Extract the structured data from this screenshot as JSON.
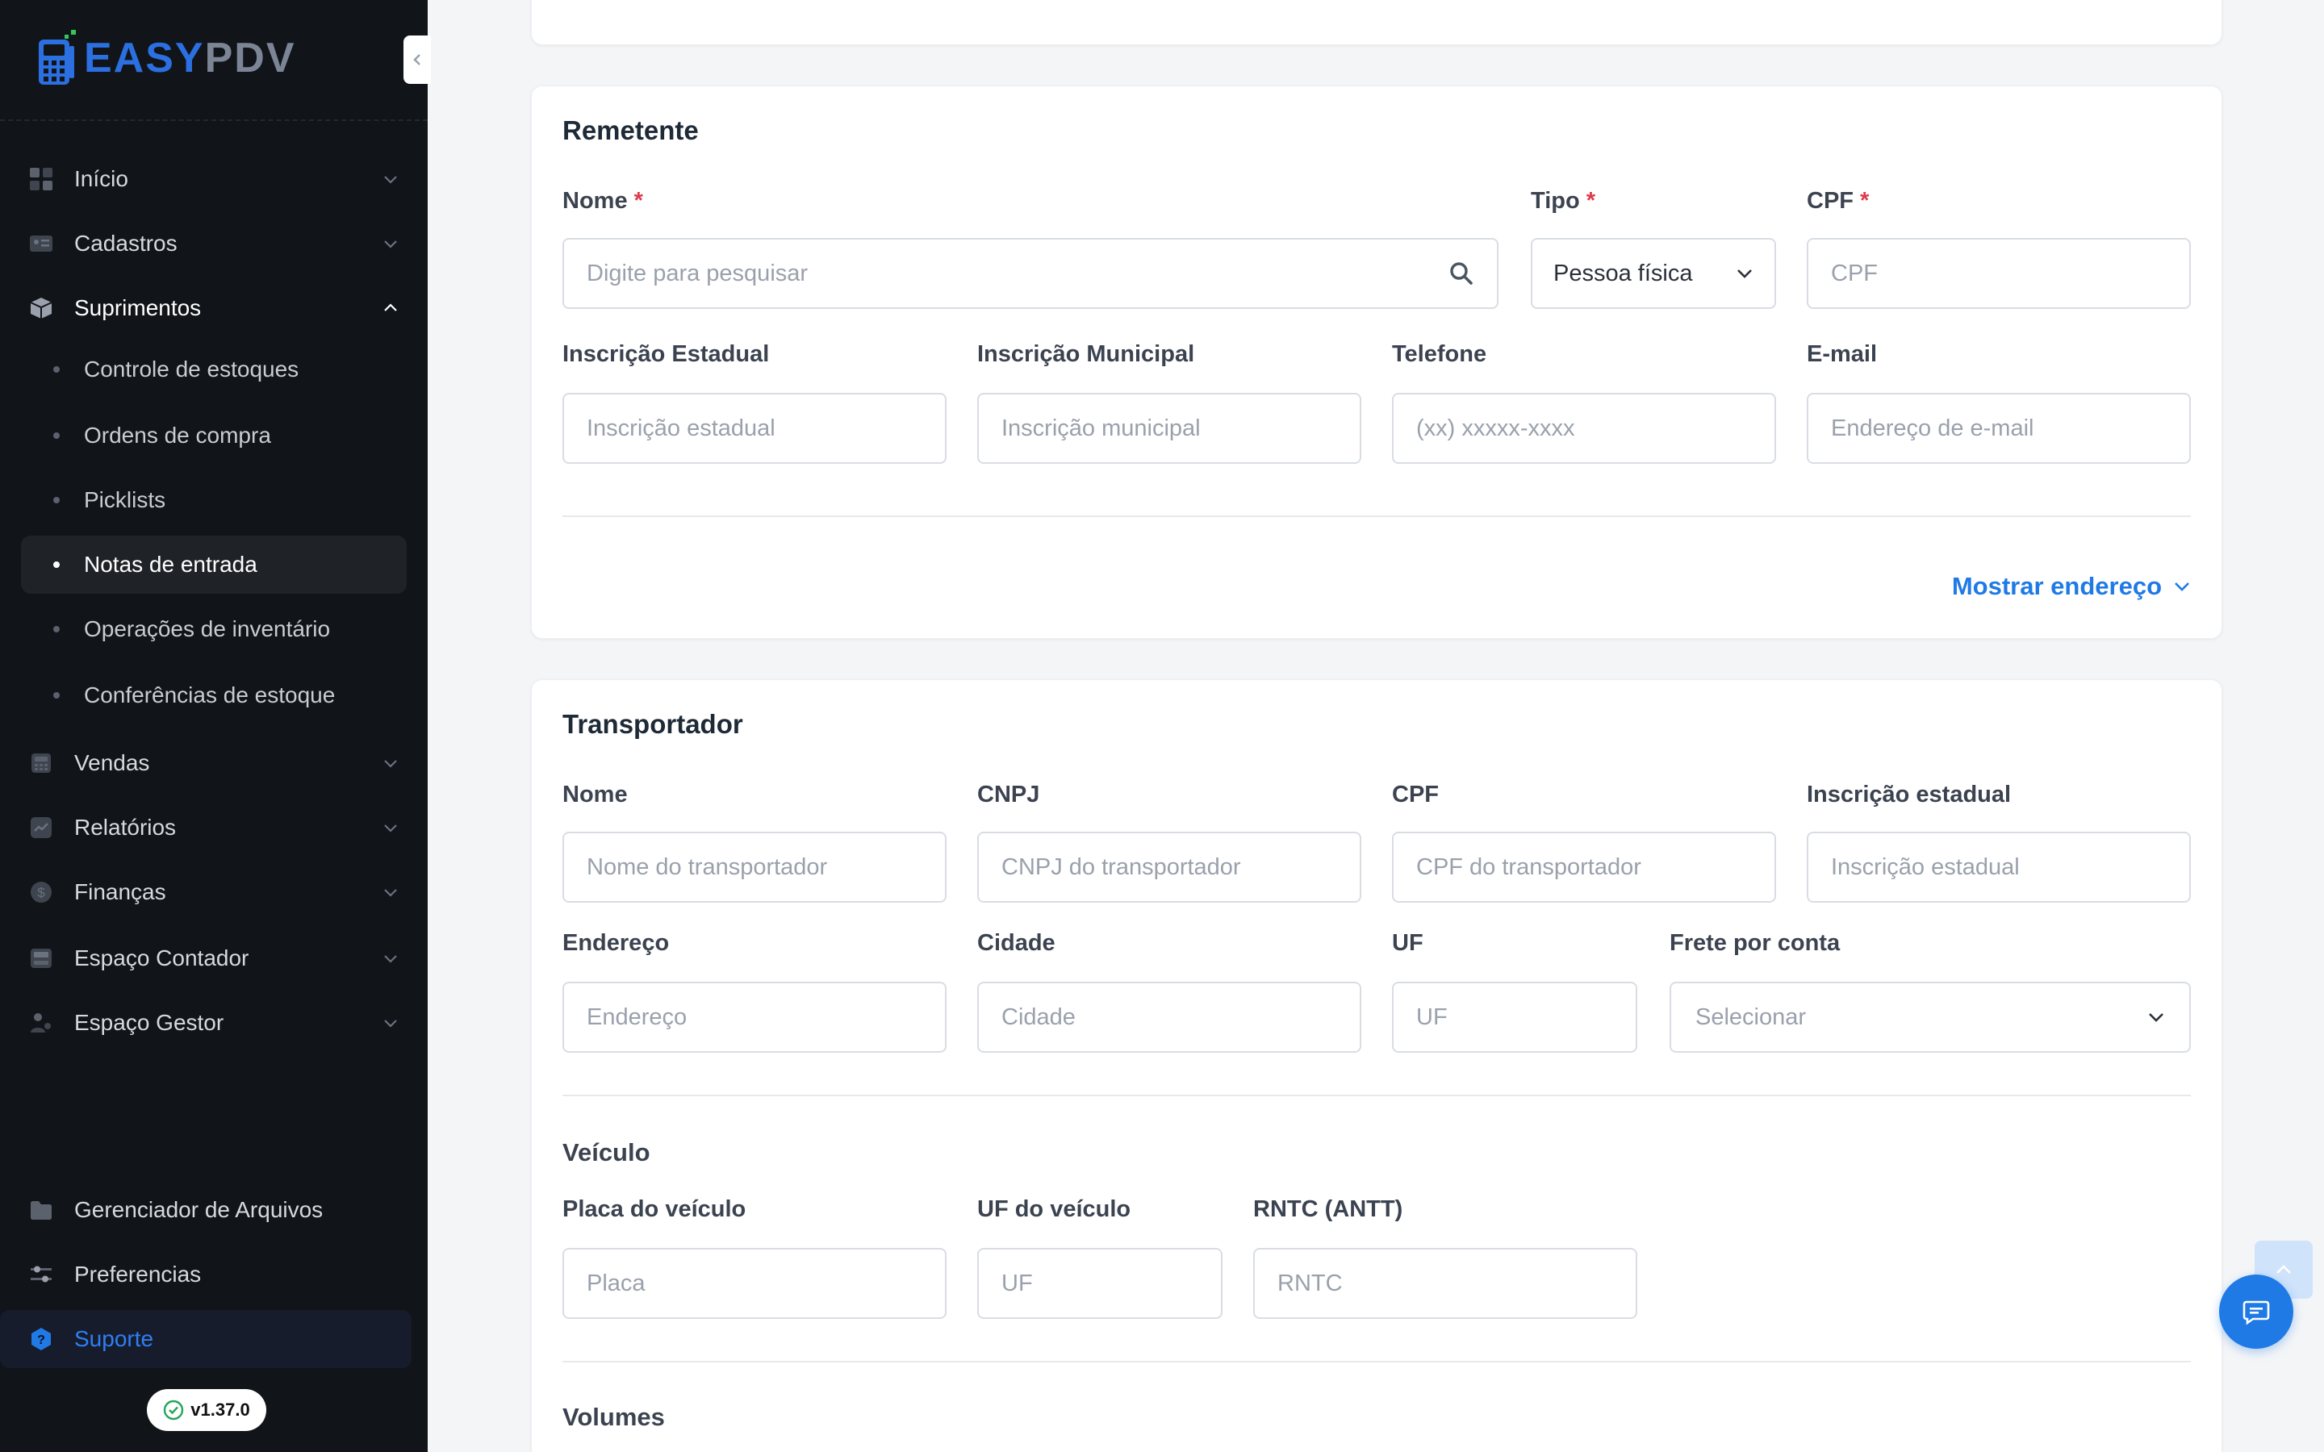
{
  "app": {
    "logo_part_a": "EASY",
    "logo_part_b": "PDV",
    "version": "v1.37.0"
  },
  "sidebar": {
    "items": [
      {
        "label": "Início",
        "icon": "grid-icon"
      },
      {
        "label": "Cadastros",
        "icon": "id-card-icon"
      },
      {
        "label": "Suprimentos",
        "icon": "box-icon",
        "expanded": true
      },
      {
        "label": "Vendas",
        "icon": "register-icon"
      },
      {
        "label": "Relatórios",
        "icon": "chart-icon"
      },
      {
        "label": "Finanças",
        "icon": "dollar-icon"
      },
      {
        "label": "Espaço Contador",
        "icon": "calculator-icon"
      },
      {
        "label": "Espaço Gestor",
        "icon": "user-icon"
      }
    ],
    "subitems": [
      {
        "label": "Controle de estoques"
      },
      {
        "label": "Ordens de compra"
      },
      {
        "label": "Picklists"
      },
      {
        "label": "Notas de entrada",
        "active": true
      },
      {
        "label": "Operações de inventário"
      },
      {
        "label": "Conferências de estoque"
      }
    ],
    "bottom": [
      {
        "label": "Gerenciador de Arquivos",
        "icon": "folder-icon"
      },
      {
        "label": "Preferencias",
        "icon": "sliders-icon"
      },
      {
        "label": "Suporte",
        "icon": "help-icon"
      }
    ]
  },
  "remetente": {
    "title": "Remetente",
    "nome_label": "Nome",
    "nome_placeholder": "Digite para pesquisar",
    "tipo_label": "Tipo",
    "tipo_value": "Pessoa física",
    "cpf_label": "CPF",
    "cpf_placeholder": "CPF",
    "ie_label": "Inscrição Estadual",
    "ie_placeholder": "Inscrição estadual",
    "im_label": "Inscrição Municipal",
    "im_placeholder": "Inscrição municipal",
    "tel_label": "Telefone",
    "tel_placeholder": "(xx) xxxxx-xxxx",
    "email_label": "E-mail",
    "email_placeholder": "Endereço de e-mail",
    "show_address": "Mostrar endereço",
    "required_mark": "*"
  },
  "transportador": {
    "title": "Transportador",
    "nome_label": "Nome",
    "nome_placeholder": "Nome do transportador",
    "cnpj_label": "CNPJ",
    "cnpj_placeholder": "CNPJ do transportador",
    "cpf_label": "CPF",
    "cpf_placeholder": "CPF do transportador",
    "ie_label": "Inscrição estadual",
    "ie_placeholder": "Inscrição estadual",
    "endereco_label": "Endereço",
    "endereco_placeholder": "Endereço",
    "cidade_label": "Cidade",
    "cidade_placeholder": "Cidade",
    "uf_label": "UF",
    "uf_placeholder": "UF",
    "frete_label": "Frete por conta",
    "frete_placeholder": "Selecionar",
    "veiculo_title": "Veículo",
    "placa_label": "Placa do veículo",
    "placa_placeholder": "Placa",
    "uf_veiculo_label": "UF do veículo",
    "uf_veiculo_placeholder": "UF",
    "rntc_label": "RNTC (ANTT)",
    "rntc_placeholder": "RNTC",
    "volumes_title": "Volumes"
  },
  "colors": {
    "sidebar_bg": "#111418",
    "accent": "#1f7ae6",
    "required": "#e0384b"
  }
}
